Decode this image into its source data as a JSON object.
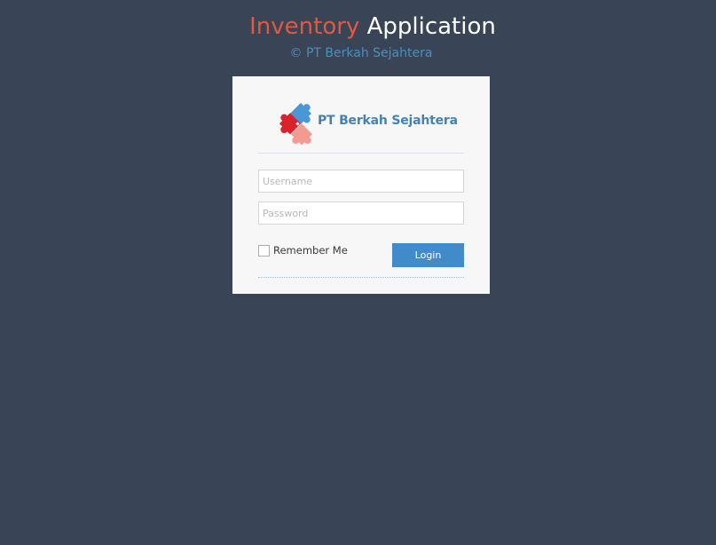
{
  "header": {
    "title_accent": "Inventory",
    "title_main": "Application",
    "copyright": "© PT Berkah Sejahtera"
  },
  "login_box": {
    "brand_name": "PT Berkah Sejahtera",
    "brand_logo_icon": "puzzle-logo-icon",
    "username": {
      "value": "",
      "placeholder": "Username"
    },
    "password": {
      "value": "",
      "placeholder": "Password"
    },
    "remember_label": "Remember Me",
    "remember_checked": false,
    "login_label": "Login"
  },
  "colors": {
    "background": "#394556",
    "title_accent": "#dd5a43",
    "copyright": "#4c8fbd",
    "brand_name": "#4383b4",
    "login_button": "#428bca",
    "puzzle_blue": "#4a97d5",
    "puzzle_red": "#d9222c",
    "puzzle_pink": "#f49b91"
  }
}
